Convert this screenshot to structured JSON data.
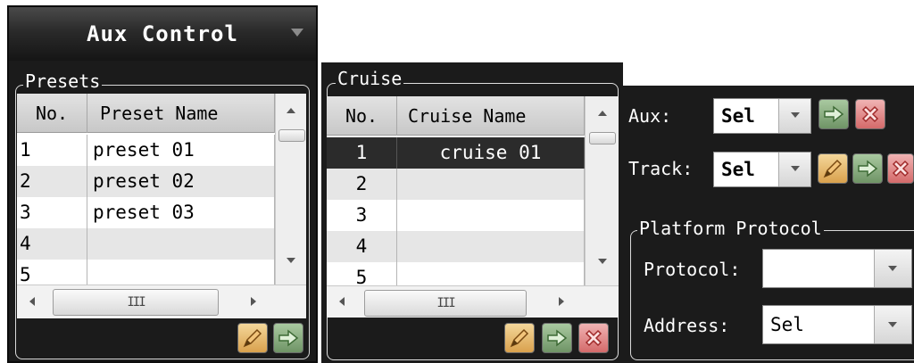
{
  "aux_control": {
    "title": "Aux Control"
  },
  "presets": {
    "group_title": "Presets",
    "columns": [
      "No.",
      "Preset Name"
    ],
    "rows": [
      {
        "no": "1",
        "name": "preset 01"
      },
      {
        "no": "2",
        "name": "preset 02"
      },
      {
        "no": "3",
        "name": "preset 03"
      },
      {
        "no": "4",
        "name": ""
      },
      {
        "no": "5",
        "name": ""
      }
    ],
    "scroll_thumb_glyph": "III"
  },
  "cruise": {
    "group_title": "Cruise",
    "columns": [
      "No.",
      "Cruise Name"
    ],
    "rows": [
      {
        "no": "1",
        "name": "cruise 01",
        "selected": true
      },
      {
        "no": "2",
        "name": ""
      },
      {
        "no": "3",
        "name": ""
      },
      {
        "no": "4",
        "name": ""
      },
      {
        "no": "5",
        "name": ""
      }
    ],
    "scroll_thumb_glyph": "III"
  },
  "aux": {
    "label": "Aux:",
    "value": "Sel"
  },
  "track": {
    "label": "Track:",
    "value": "Sel"
  },
  "platform_protocol": {
    "group_title": "Platform Protocol",
    "protocol_label": "Protocol:",
    "protocol_value": "",
    "address_label": "Address:",
    "address_value": "Sel"
  },
  "icons": {
    "edit": "pencil-icon",
    "go": "arrow-right-icon",
    "delete": "close-x-icon"
  },
  "colors": {
    "panel_bg": "#1b1b1b",
    "selected_row": "#2b2b2b",
    "alt_row": "#e6e6e6",
    "go_button": "#7fa577",
    "delete_button": "#e07c7c",
    "edit_button": "#e2b25c"
  }
}
